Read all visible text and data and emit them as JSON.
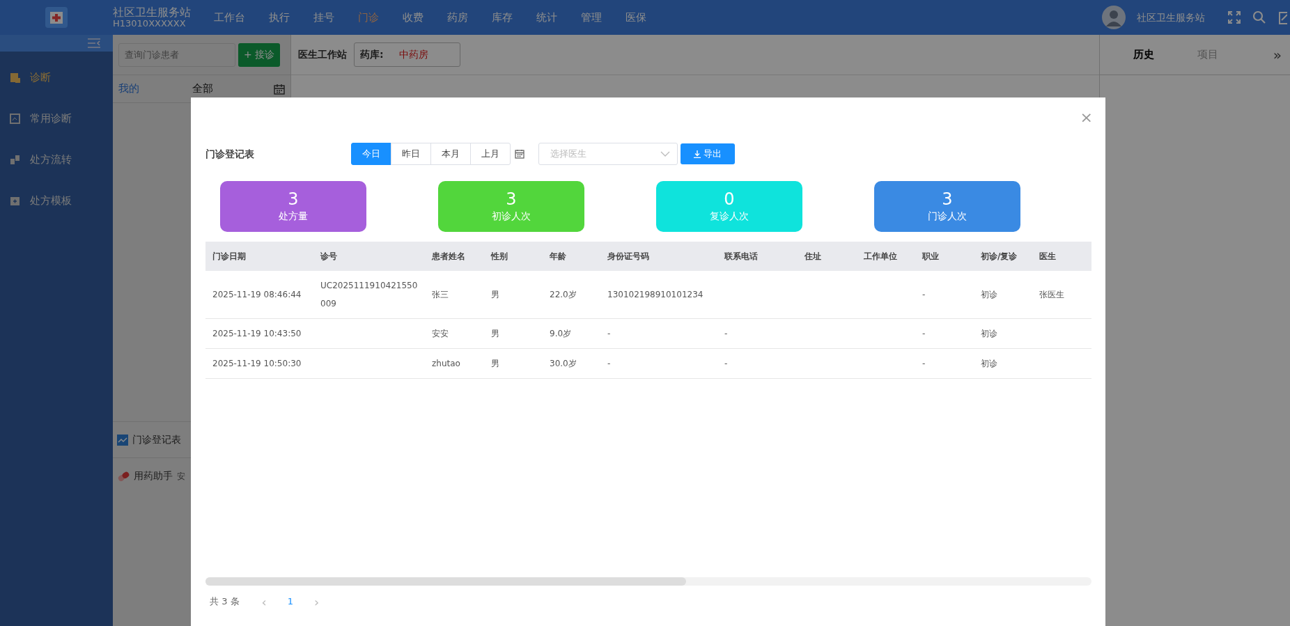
{
  "header": {
    "org_name": "社区卫生服务站",
    "org_code": "H13010XXXXXX",
    "user_name": "社区卫生服务站"
  },
  "nav": [
    {
      "label": "工作台",
      "selected": false
    },
    {
      "label": "执行",
      "selected": false
    },
    {
      "label": "挂号",
      "selected": false
    },
    {
      "label": "门诊",
      "selected": true
    },
    {
      "label": "收费",
      "selected": false
    },
    {
      "label": "药房",
      "selected": false
    },
    {
      "label": "库存",
      "selected": false
    },
    {
      "label": "统计",
      "selected": false
    },
    {
      "label": "管理",
      "selected": false
    },
    {
      "label": "医保",
      "selected": false
    }
  ],
  "sidebar": {
    "items": [
      {
        "label": "诊断",
        "selected": true
      },
      {
        "label": "常用诊断",
        "selected": false
      },
      {
        "label": "处方流转",
        "selected": false
      },
      {
        "label": "处方模板",
        "selected": false
      }
    ]
  },
  "patient_panel": {
    "search": {
      "placeholder": "查询门诊患者"
    },
    "add_button": "+ 接诊",
    "tabs": [
      {
        "label": "我的",
        "selected": true
      },
      {
        "label": "全部",
        "selected": false
      }
    ],
    "tools": [
      {
        "label": "门诊登记表"
      },
      {
        "label": "用药助手",
        "note": "安"
      }
    ]
  },
  "workspace": {
    "title": "医生工作站",
    "pharmacy_label": "药库:",
    "pharmacy_value": "中药房"
  },
  "right_panel": {
    "tabs": [
      {
        "label": "历史",
        "selected": true
      },
      {
        "label": "项目",
        "selected": false
      }
    ],
    "collapse": "»"
  },
  "modal": {
    "close": "×",
    "title": "门诊登记表",
    "periods": [
      {
        "label": "今日",
        "selected": true
      },
      {
        "label": "昨日",
        "selected": false
      },
      {
        "label": "本月",
        "selected": false
      },
      {
        "label": "上月",
        "selected": false
      }
    ],
    "doctor_select": {
      "placeholder": "选择医生"
    },
    "export_button": "导出",
    "stats": [
      {
        "value": "3",
        "label": "处方量",
        "color": "#a65fdc"
      },
      {
        "value": "3",
        "label": "初诊人次",
        "color": "#52d63c"
      },
      {
        "value": "0",
        "label": "复诊人次",
        "color": "#0fe3dc"
      },
      {
        "value": "3",
        "label": "门诊人次",
        "color": "#3a8ae3"
      }
    ],
    "table": {
      "columns": [
        "门诊日期",
        "诊号",
        "患者姓名",
        "性别",
        "年龄",
        "身份证号码",
        "联系电话",
        "住址",
        "工作单位",
        "职业",
        "初诊/复诊",
        "医生"
      ],
      "rows": [
        [
          "2025-11-19 08:46:44",
          "UC2025111910421550009",
          "张三",
          "男",
          "22.0岁",
          "130102198910101234",
          "",
          "",
          "",
          "-",
          "初诊",
          "张医生"
        ],
        [
          "2025-11-19 10:43:50",
          "",
          "安安",
          "男",
          "9.0岁",
          "-",
          "-",
          "",
          "",
          "-",
          "初诊",
          ""
        ],
        [
          "2025-11-19 10:50:30",
          "",
          "zhutao",
          "男",
          "30.0岁",
          "-",
          "-",
          "",
          "",
          "-",
          "初诊",
          ""
        ]
      ]
    },
    "pagination": {
      "total": "共 3 条",
      "prev": "‹",
      "page": "1",
      "next": "›"
    }
  }
}
